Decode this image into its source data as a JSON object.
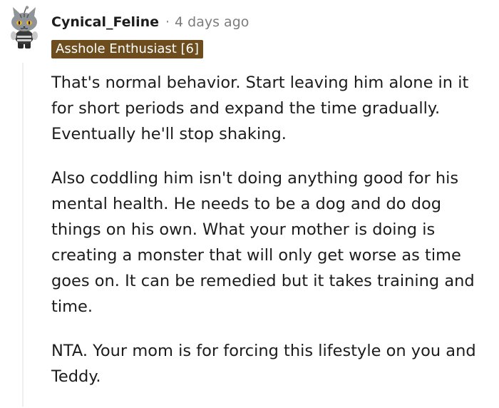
{
  "comment": {
    "author": {
      "username": "Cynical_Feline",
      "avatar_icon": "snoo-avatar-icon"
    },
    "separator": "·",
    "timestamp": "4 days ago",
    "flair": {
      "text": "Asshole Enthusiast [6]",
      "background_color": "#6d4c1d",
      "text_color": "#ffffff"
    },
    "paragraphs": [
      "That's normal behavior. Start leaving him alone in it for short periods and expand the time gradually. Eventually he'll stop shaking.",
      "Also coddling him isn't doing anything good for his mental health. He needs to be a dog and do dog things on his own. What your mother is doing is creating a monster that will only get worse as time goes on. It can be remedied but it takes training and time.",
      "NTA. Your mom is for forcing this lifestyle on you and Teddy."
    ]
  },
  "colors": {
    "text": "#1c1c1c",
    "meta_text": "#7c7c7c",
    "thread_line": "#edeff1"
  }
}
